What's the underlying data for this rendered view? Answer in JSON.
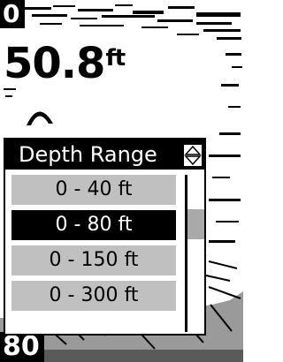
{
  "readout": {
    "top_depth": "0",
    "current_depth": "50.8",
    "depth_unit": "ft",
    "bottom_depth": "80"
  },
  "menu": {
    "title": "Depth Range",
    "items": [
      {
        "label": "0 - 40 ft",
        "selected": false
      },
      {
        "label": "0 - 80 ft",
        "selected": true
      },
      {
        "label": "0 - 150 ft",
        "selected": false
      },
      {
        "label": "0 - 300 ft",
        "selected": false
      }
    ]
  },
  "colors": {
    "foreground": "#000000",
    "background": "#ffffff",
    "item_background": "#c0c0c0",
    "scroll_thumb": "#a9a9a9"
  }
}
